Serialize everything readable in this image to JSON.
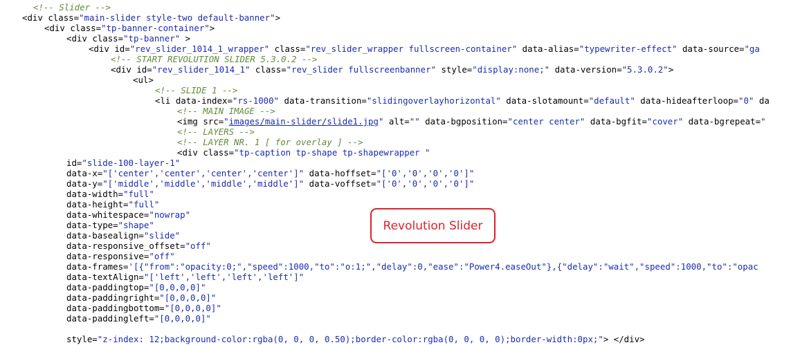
{
  "code_lines": [
    {
      "indent": 48,
      "tokens": [
        {
          "t": "<!-- Slider -->",
          "c": "comment"
        }
      ]
    },
    {
      "indent": 32,
      "tokens": [
        {
          "t": "<div ",
          "c": "tag"
        },
        {
          "t": "class=",
          "c": "attr"
        },
        {
          "t": "\"main-slider style-two default-banner\"",
          "c": "str"
        },
        {
          "t": ">",
          "c": "tag"
        }
      ]
    },
    {
      "indent": 64,
      "tokens": [
        {
          "t": "<div ",
          "c": "tag"
        },
        {
          "t": "class=",
          "c": "attr"
        },
        {
          "t": "\"tp-banner-container\"",
          "c": "str"
        },
        {
          "t": ">",
          "c": "tag"
        }
      ]
    },
    {
      "indent": 96,
      "tokens": [
        {
          "t": "<div ",
          "c": "tag"
        },
        {
          "t": "class=",
          "c": "attr"
        },
        {
          "t": "\"tp-banner\"",
          "c": "str"
        },
        {
          "t": " >",
          "c": "tag"
        }
      ]
    },
    {
      "indent": 128,
      "tokens": [
        {
          "t": "<div ",
          "c": "tag"
        },
        {
          "t": "id=",
          "c": "attr"
        },
        {
          "t": "\"rev_slider_1014_1_wrapper\"",
          "c": "str"
        },
        {
          "t": " class=",
          "c": "attr"
        },
        {
          "t": "\"rev_slider_wrapper fullscreen-container\"",
          "c": "str"
        },
        {
          "t": " data-alias=",
          "c": "attr"
        },
        {
          "t": "\"typewriter-effect\"",
          "c": "str"
        },
        {
          "t": " data-source=",
          "c": "attr"
        },
        {
          "t": "\"ga",
          "c": "str"
        }
      ]
    },
    {
      "indent": 160,
      "tokens": [
        {
          "t": "<!-- START REVOLUTION SLIDER 5.3.0.2 -->",
          "c": "comment"
        }
      ]
    },
    {
      "indent": 160,
      "tokens": [
        {
          "t": "<div ",
          "c": "tag"
        },
        {
          "t": "id=",
          "c": "attr"
        },
        {
          "t": "\"rev_slider_1014_1\"",
          "c": "str"
        },
        {
          "t": " class=",
          "c": "attr"
        },
        {
          "t": "\"rev_slider fullscreenbanner\"",
          "c": "str"
        },
        {
          "t": " style=",
          "c": "attr"
        },
        {
          "t": "\"display:none;\"",
          "c": "str"
        },
        {
          "t": " data-version=",
          "c": "attr"
        },
        {
          "t": "\"5.3.0.2\"",
          "c": "str"
        },
        {
          "t": ">",
          "c": "tag"
        }
      ]
    },
    {
      "indent": 192,
      "tokens": [
        {
          "t": "<ul>",
          "c": "tag"
        }
      ]
    },
    {
      "indent": 224,
      "tokens": [
        {
          "t": "<!-- SLIDE 1 -->",
          "c": "comment"
        }
      ]
    },
    {
      "indent": 224,
      "tokens": [
        {
          "t": "<li ",
          "c": "tag"
        },
        {
          "t": "data-index=",
          "c": "attr"
        },
        {
          "t": "\"rs-1000\"",
          "c": "str"
        },
        {
          "t": " data-transition=",
          "c": "attr"
        },
        {
          "t": "\"slidingoverlayhorizontal\"",
          "c": "str"
        },
        {
          "t": " data-slotamount=",
          "c": "attr"
        },
        {
          "t": "\"default\"",
          "c": "str"
        },
        {
          "t": " data-hideafterloop=",
          "c": "attr"
        },
        {
          "t": "\"0\"",
          "c": "str"
        },
        {
          "t": " da",
          "c": "attr"
        }
      ]
    },
    {
      "indent": 256,
      "tokens": [
        {
          "t": "<!-- MAIN IMAGE -->",
          "c": "comment"
        }
      ]
    },
    {
      "indent": 256,
      "tokens": [
        {
          "t": "<img ",
          "c": "tag"
        },
        {
          "t": "src=",
          "c": "attr"
        },
        {
          "t": "\"",
          "c": "str"
        },
        {
          "t": "images/main-slider/slide1.jpg",
          "c": "link"
        },
        {
          "t": "\"",
          "c": "str"
        },
        {
          "t": " alt=",
          "c": "attr"
        },
        {
          "t": "\"\"",
          "c": "str"
        },
        {
          "t": " data-bgposition=",
          "c": "attr"
        },
        {
          "t": "\"center center\"",
          "c": "str"
        },
        {
          "t": " data-bgfit=",
          "c": "attr"
        },
        {
          "t": "\"cover\"",
          "c": "str"
        },
        {
          "t": " data-bgrepeat=",
          "c": "attr"
        },
        {
          "t": "\"",
          "c": "str"
        }
      ]
    },
    {
      "indent": 256,
      "tokens": [
        {
          "t": "<!-- LAYERS -->",
          "c": "comment"
        }
      ]
    },
    {
      "indent": 256,
      "tokens": [
        {
          "t": "<!-- LAYER NR. 1 [ for overlay ] -->",
          "c": "comment"
        }
      ]
    },
    {
      "indent": 256,
      "tokens": [
        {
          "t": "<div ",
          "c": "tag"
        },
        {
          "t": "class=",
          "c": "attr"
        },
        {
          "t": "\"tp-caption tp-shape tp-shapewrapper \"",
          "c": "str"
        }
      ]
    },
    {
      "indent": 96,
      "tokens": [
        {
          "t": "id=",
          "c": "attr"
        },
        {
          "t": "\"slide-100-layer-1\"",
          "c": "str"
        }
      ]
    },
    {
      "indent": 96,
      "tokens": [
        {
          "t": "data-x=",
          "c": "attr"
        },
        {
          "t": "\"['center','center','center','center']\"",
          "c": "str"
        },
        {
          "t": " data-hoffset=",
          "c": "attr"
        },
        {
          "t": "\"['0','0','0','0']\"",
          "c": "str"
        }
      ]
    },
    {
      "indent": 96,
      "tokens": [
        {
          "t": "data-y=",
          "c": "attr"
        },
        {
          "t": "\"['middle','middle','middle','middle']\"",
          "c": "str"
        },
        {
          "t": " data-voffset=",
          "c": "attr"
        },
        {
          "t": "\"['0','0','0','0']\"",
          "c": "str"
        }
      ]
    },
    {
      "indent": 96,
      "tokens": [
        {
          "t": "data-width=",
          "c": "attr"
        },
        {
          "t": "\"full\"",
          "c": "str"
        }
      ]
    },
    {
      "indent": 96,
      "tokens": [
        {
          "t": "data-height=",
          "c": "attr"
        },
        {
          "t": "\"full\"",
          "c": "str"
        }
      ]
    },
    {
      "indent": 96,
      "tokens": [
        {
          "t": "data-whitespace=",
          "c": "attr"
        },
        {
          "t": "\"nowrap\"",
          "c": "str"
        }
      ]
    },
    {
      "indent": 96,
      "tokens": [
        {
          "t": "data-type=",
          "c": "attr"
        },
        {
          "t": "\"shape\"",
          "c": "str"
        }
      ]
    },
    {
      "indent": 96,
      "tokens": [
        {
          "t": "data-basealign=",
          "c": "attr"
        },
        {
          "t": "\"slide\"",
          "c": "str"
        }
      ]
    },
    {
      "indent": 96,
      "tokens": [
        {
          "t": "data-responsive_offset=",
          "c": "attr"
        },
        {
          "t": "\"off\"",
          "c": "str"
        }
      ]
    },
    {
      "indent": 96,
      "tokens": [
        {
          "t": "data-responsive=",
          "c": "attr"
        },
        {
          "t": "\"off\"",
          "c": "str"
        }
      ]
    },
    {
      "indent": 96,
      "tokens": [
        {
          "t": "data-frames=",
          "c": "attr"
        },
        {
          "t": "'[{\"from\":\"opacity:0;\",\"speed\":1000,\"to\":\"o:1;\",\"delay\":0,\"ease\":\"Power4.easeOut\"},{\"delay\":\"wait\",\"speed\":1000,\"to\":\"opac",
          "c": "str"
        }
      ]
    },
    {
      "indent": 96,
      "tokens": [
        {
          "t": "data-textAlign=",
          "c": "attr"
        },
        {
          "t": "\"['left','left','left','left']\"",
          "c": "str"
        }
      ]
    },
    {
      "indent": 96,
      "tokens": [
        {
          "t": "data-paddingtop=",
          "c": "attr"
        },
        {
          "t": "\"[0,0,0,0]\"",
          "c": "str"
        }
      ]
    },
    {
      "indent": 96,
      "tokens": [
        {
          "t": "data-paddingright=",
          "c": "attr"
        },
        {
          "t": "\"[0,0,0,0]\"",
          "c": "str"
        }
      ]
    },
    {
      "indent": 96,
      "tokens": [
        {
          "t": "data-paddingbottom=",
          "c": "attr"
        },
        {
          "t": "\"[0,0,0,0]\"",
          "c": "str"
        }
      ]
    },
    {
      "indent": 96,
      "tokens": [
        {
          "t": "data-paddingleft=",
          "c": "attr"
        },
        {
          "t": "\"[0,0,0,0]\"",
          "c": "str"
        }
      ]
    },
    {
      "indent": 96,
      "tokens": []
    },
    {
      "indent": 96,
      "tokens": [
        {
          "t": "style=",
          "c": "attr"
        },
        {
          "t": "\"z-index: 12;background-color:rgba(0, 0, 0, 0.50);border-color:rgba(0, 0, 0, 0);border-width:0px;\"",
          "c": "str"
        },
        {
          "t": "> </div>",
          "c": "tag"
        }
      ]
    }
  ],
  "callout": {
    "label": "Revolution Slider",
    "color": "#e0202a"
  },
  "colors": {
    "comment": "#5f8a3a",
    "string": "#1b2bb0",
    "plain": "#000000",
    "background": "#ffffff"
  }
}
